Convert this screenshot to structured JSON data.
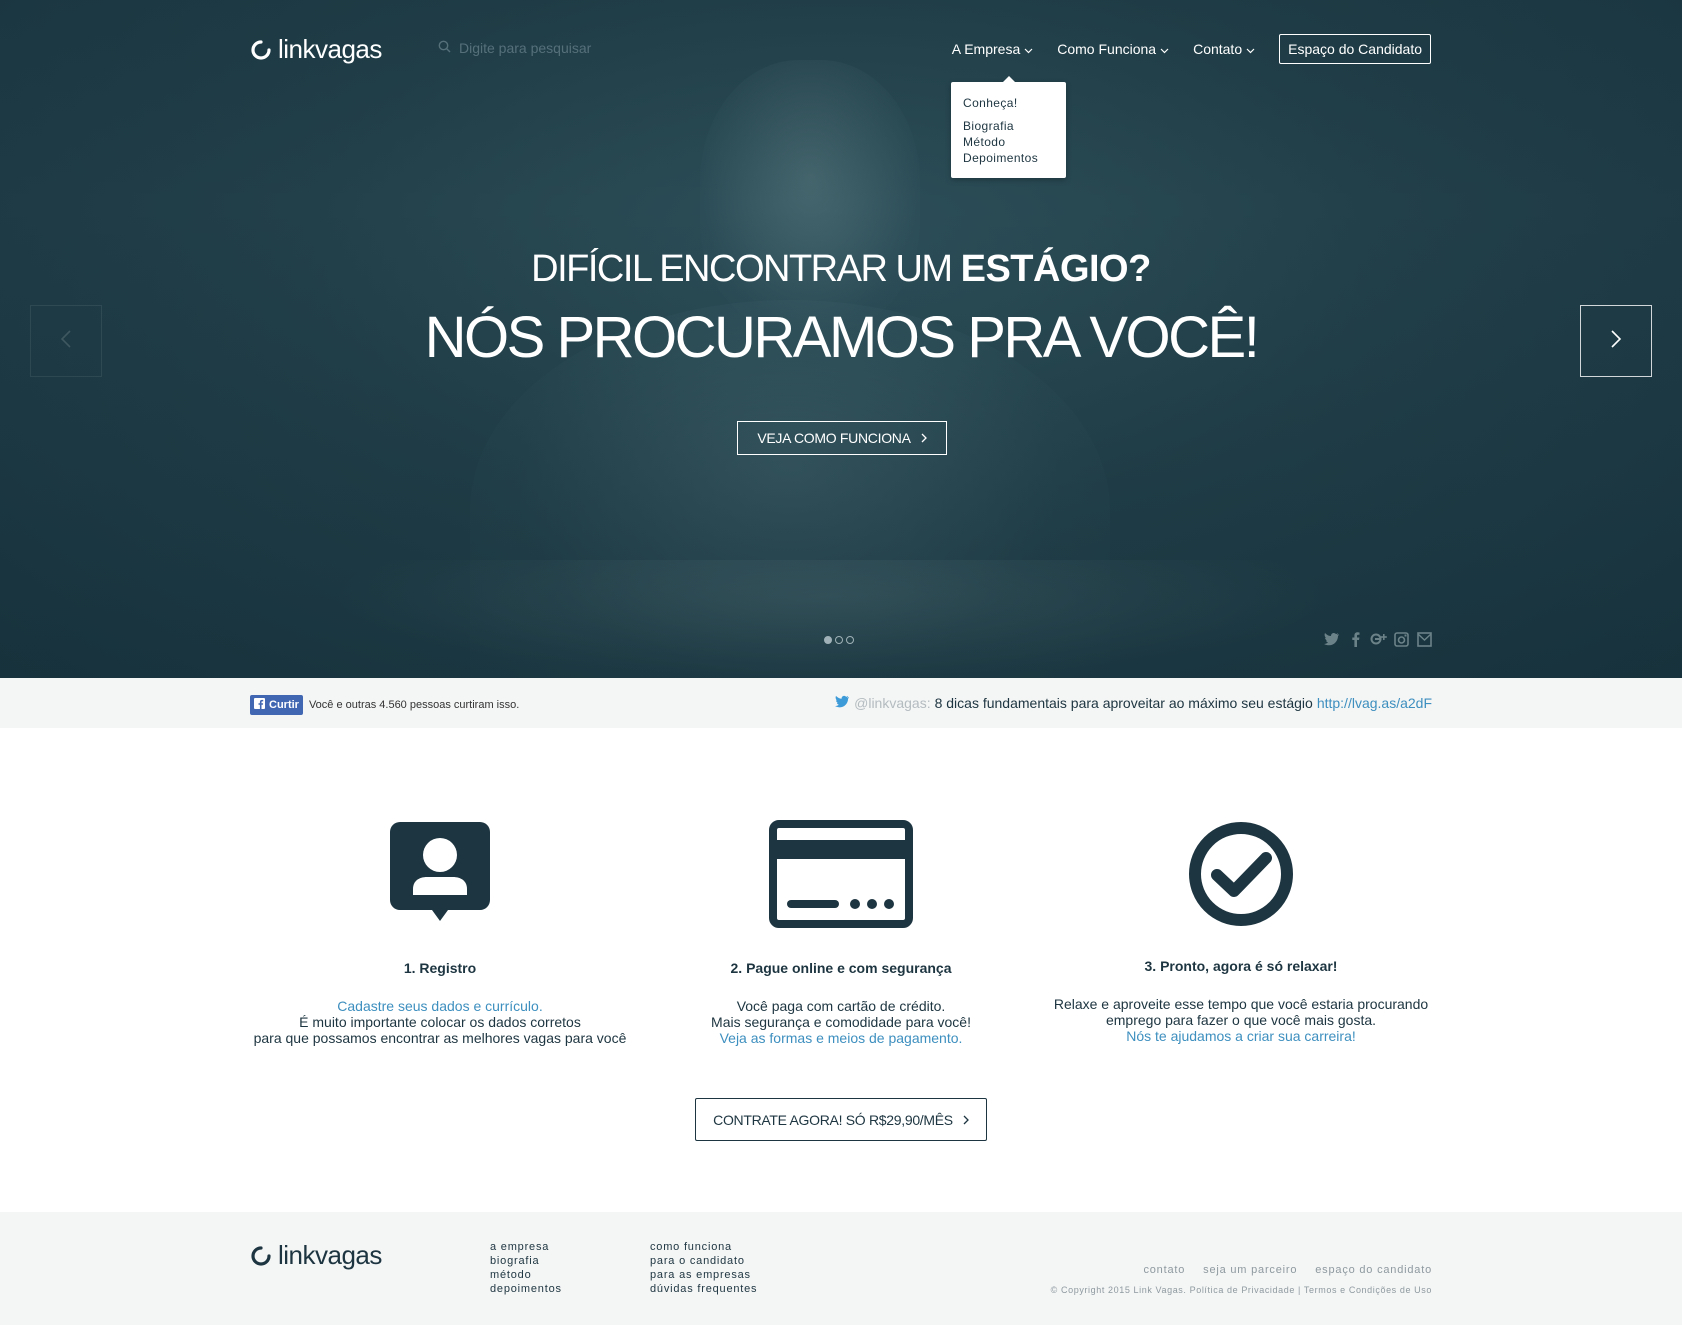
{
  "brand": {
    "name_bold": "link",
    "name_rest": "vagas"
  },
  "search": {
    "placeholder": "Digite para pesquisar"
  },
  "nav": {
    "items": [
      {
        "label": "A Empresa"
      },
      {
        "label": "Como Funciona"
      },
      {
        "label": "Contato"
      }
    ],
    "candidate_button": "Espaço do Candidato"
  },
  "dropdown": {
    "title": "Conheça!",
    "links": [
      "Biografia",
      "Método",
      "Depoimentos"
    ]
  },
  "hero": {
    "title_line1_regular": "DIFÍCIL ENCONTRAR UM ",
    "title_line1_bold": "ESTÁGIO?",
    "title_line2": "NÓS PROCURAMOS PRA VOCÊ!",
    "cta": "VEJA COMO FUNCIONA",
    "slides_total": 3,
    "active_slide": 1
  },
  "social_icons": [
    "twitter-icon",
    "facebook-icon",
    "google-plus-icon",
    "instagram-icon",
    "email-icon"
  ],
  "strip": {
    "fb_button": "Curtir",
    "fb_text": "Você e outras 4.560 pessoas curtiram isso.",
    "tweet_handle": "@linkvagas:",
    "tweet_text": "8 dicas fundamentais para aproveitar ao máximo seu estágio",
    "tweet_link": "http://lvag.as/a2dF"
  },
  "features": [
    {
      "title": "1. Registro",
      "line1": "Cadastre seus dados e currículo.",
      "line2": "É muito importante colocar os dados corretos",
      "line3": "para que possamos encontrar as melhores vagas para você"
    },
    {
      "title": "2. Pague online e com segurança",
      "line1": "Você paga com cartão de crédito.",
      "line2": "Mais segurança e comodidade para você!",
      "line3": "Veja as formas e meios de pagamento."
    },
    {
      "title": "3. Pronto, agora é só relaxar!",
      "line1": "Relaxe e aproveite esse tempo que você estaria procurando",
      "line2": "emprego para fazer o que você mais gosta.",
      "line3": "Nós te ajudamos a criar sua carreira!"
    }
  ],
  "cta_main": "CONTRATE AGORA! SÓ R$29,90/MÊS",
  "footer": {
    "col1": {
      "head": "a empresa",
      "links": [
        "biografia",
        "método",
        "depoimentos"
      ]
    },
    "col2": {
      "head": "como funciona",
      "links": [
        "para o candidato",
        "para as empresas",
        "dúvidas frequentes"
      ]
    },
    "links": [
      "contato",
      "seja um parceiro",
      "espaço do candidato"
    ],
    "copyright": "© Copyright 2015 Link Vagas. Política de Privacidade | Termos e Condições de Uso"
  },
  "colors": {
    "primary": "#1d3540",
    "accent_link": "#3d8fbf",
    "hero_overlay": "#22404a",
    "strip_bg": "#f4f5f5"
  }
}
